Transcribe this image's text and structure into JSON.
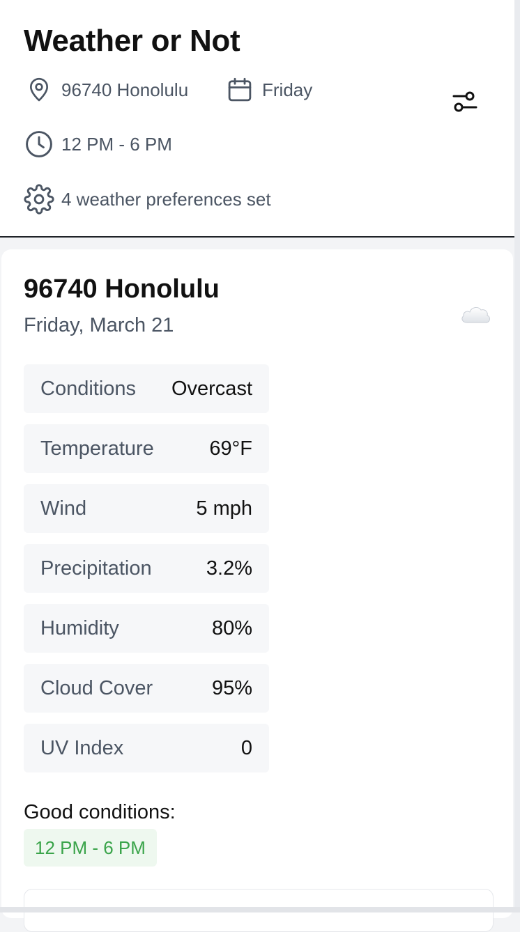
{
  "app": {
    "title": "Weather or Not"
  },
  "header": {
    "location": "96740 Honolulu",
    "day": "Friday",
    "time_range": "12 PM - 6 PM",
    "preferences": "4 weather preferences set",
    "icons": {
      "location": "map-pin-icon",
      "day": "calendar-icon",
      "time": "clock-icon",
      "preferences": "gear-icon",
      "filter": "sliders-icon"
    }
  },
  "forecast": {
    "location_title": "96740 Honolulu",
    "date": "Friday, March 21",
    "weather_icon": "cloud-icon",
    "stats": [
      {
        "label": "Conditions",
        "value": "Overcast"
      },
      {
        "label": "Temperature",
        "value": "69°F"
      },
      {
        "label": "Wind",
        "value": "5 mph"
      },
      {
        "label": "Precipitation",
        "value": "3.2%"
      },
      {
        "label": "Humidity",
        "value": "80%"
      },
      {
        "label": "Cloud Cover",
        "value": "95%"
      },
      {
        "label": "UV Index",
        "value": "0"
      }
    ],
    "good_conditions_label": "Good conditions:",
    "good_conditions_range": "12 PM - 6 PM"
  },
  "colors": {
    "accent_green": "#3aa44a",
    "badge_bg": "#eef8ef",
    "muted_text": "#4b5563",
    "row_bg": "#f6f7f9"
  }
}
